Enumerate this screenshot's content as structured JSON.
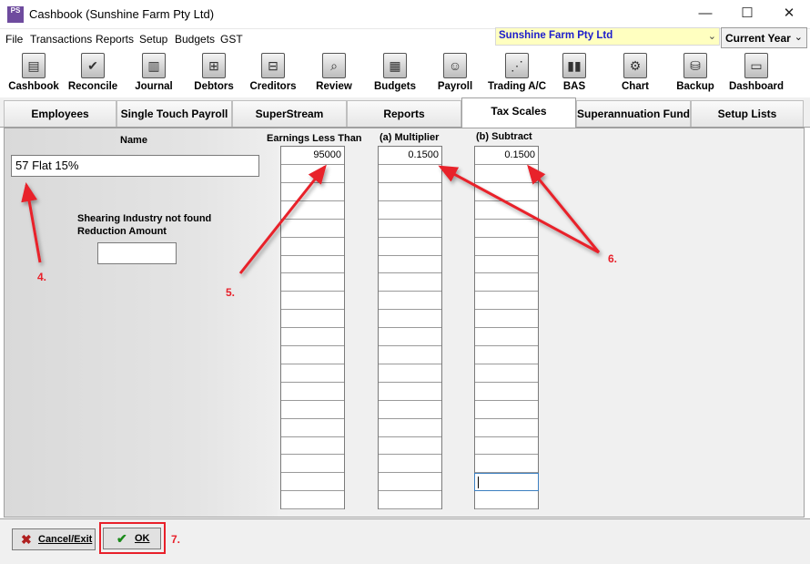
{
  "window": {
    "title": "Cashbook (Sunshine Farm Pty Ltd)",
    "app_icon_text": "PS",
    "minimize_glyph": "—",
    "maximize_glyph": "☐",
    "close_glyph": "✕"
  },
  "menu": {
    "items": [
      "File",
      "Transactions",
      "Reports",
      "Setup",
      "Budgets",
      "GST"
    ]
  },
  "company": {
    "selected": "Sunshine Farm Pty Ltd",
    "chevron": "⌄"
  },
  "period": {
    "selected": "Current Year",
    "chevron": "⌄"
  },
  "toolbar": {
    "items": [
      {
        "label": "Cashbook",
        "icon": "cashbook-icon",
        "glyph": "▤"
      },
      {
        "label": "Reconcile",
        "icon": "reconcile-icon",
        "glyph": "✔"
      },
      {
        "label": "Journal",
        "icon": "journal-icon",
        "glyph": "▥"
      },
      {
        "label": "Debtors",
        "icon": "debtors-icon",
        "glyph": "⊞"
      },
      {
        "label": "Creditors",
        "icon": "creditors-icon",
        "glyph": "⊟"
      },
      {
        "label": "Review",
        "icon": "review-icon",
        "glyph": "⌕"
      },
      {
        "label": "Budgets",
        "icon": "budgets-icon",
        "glyph": "▦"
      },
      {
        "label": "Payroll",
        "icon": "payroll-icon",
        "glyph": "☺"
      },
      {
        "label": "Trading A/C",
        "icon": "trading-icon",
        "glyph": "⋰"
      },
      {
        "label": "BAS",
        "icon": "bas-icon",
        "glyph": "▮▮"
      },
      {
        "label": "Chart",
        "icon": "chart-icon",
        "glyph": "⚙"
      },
      {
        "label": "Backup",
        "icon": "backup-icon",
        "glyph": "⛁"
      },
      {
        "label": "Dashboard",
        "icon": "dashboard-icon",
        "glyph": "▭"
      }
    ]
  },
  "tabs": [
    {
      "label": "Employees"
    },
    {
      "label": "Single Touch Payroll"
    },
    {
      "label": "SuperStream"
    },
    {
      "label": "Reports"
    },
    {
      "label": "Tax Scales",
      "active": true
    },
    {
      "label": "Superannuation Funds"
    },
    {
      "label": "Setup Lists"
    }
  ],
  "form": {
    "name_label": "Name",
    "name_value": "57 Flat 15%",
    "reduction_label_line1": "Shearing Industry not found",
    "reduction_label_line2": "Reduction Amount",
    "reduction_value": "",
    "col_earnings_header": "Earnings Less Than",
    "col_multiplier_header": "(a) Multiplier",
    "col_subtract_header": "(b) Subtract",
    "earnings": [
      "95000",
      "",
      "",
      "",
      "",
      "",
      "",
      "",
      "",
      "",
      "",
      "",
      "",
      "",
      "",
      "",
      "",
      "",
      "",
      ""
    ],
    "multiplier": [
      "0.1500",
      "",
      "",
      "",
      "",
      "",
      "",
      "",
      "",
      "",
      "",
      "",
      "",
      "",
      "",
      "",
      "",
      "",
      "",
      ""
    ],
    "subtract": [
      "0.1500",
      "",
      "",
      "",
      "",
      "",
      "",
      "",
      "",
      "",
      "",
      "",
      "",
      "",
      "",
      "",
      "",
      "",
      "",
      ""
    ]
  },
  "buttons": {
    "cancel_label": "Cancel/Exit",
    "cancel_icon": "✖",
    "ok_label": "OK",
    "ok_icon": "✔"
  },
  "annotations": {
    "a4": "4.",
    "a5": "5.",
    "a6": "6.",
    "a7": "7."
  },
  "colors": {
    "annotation": "#e8202a",
    "company_text": "#1c1ccc",
    "company_bg": "#ffffc0"
  }
}
